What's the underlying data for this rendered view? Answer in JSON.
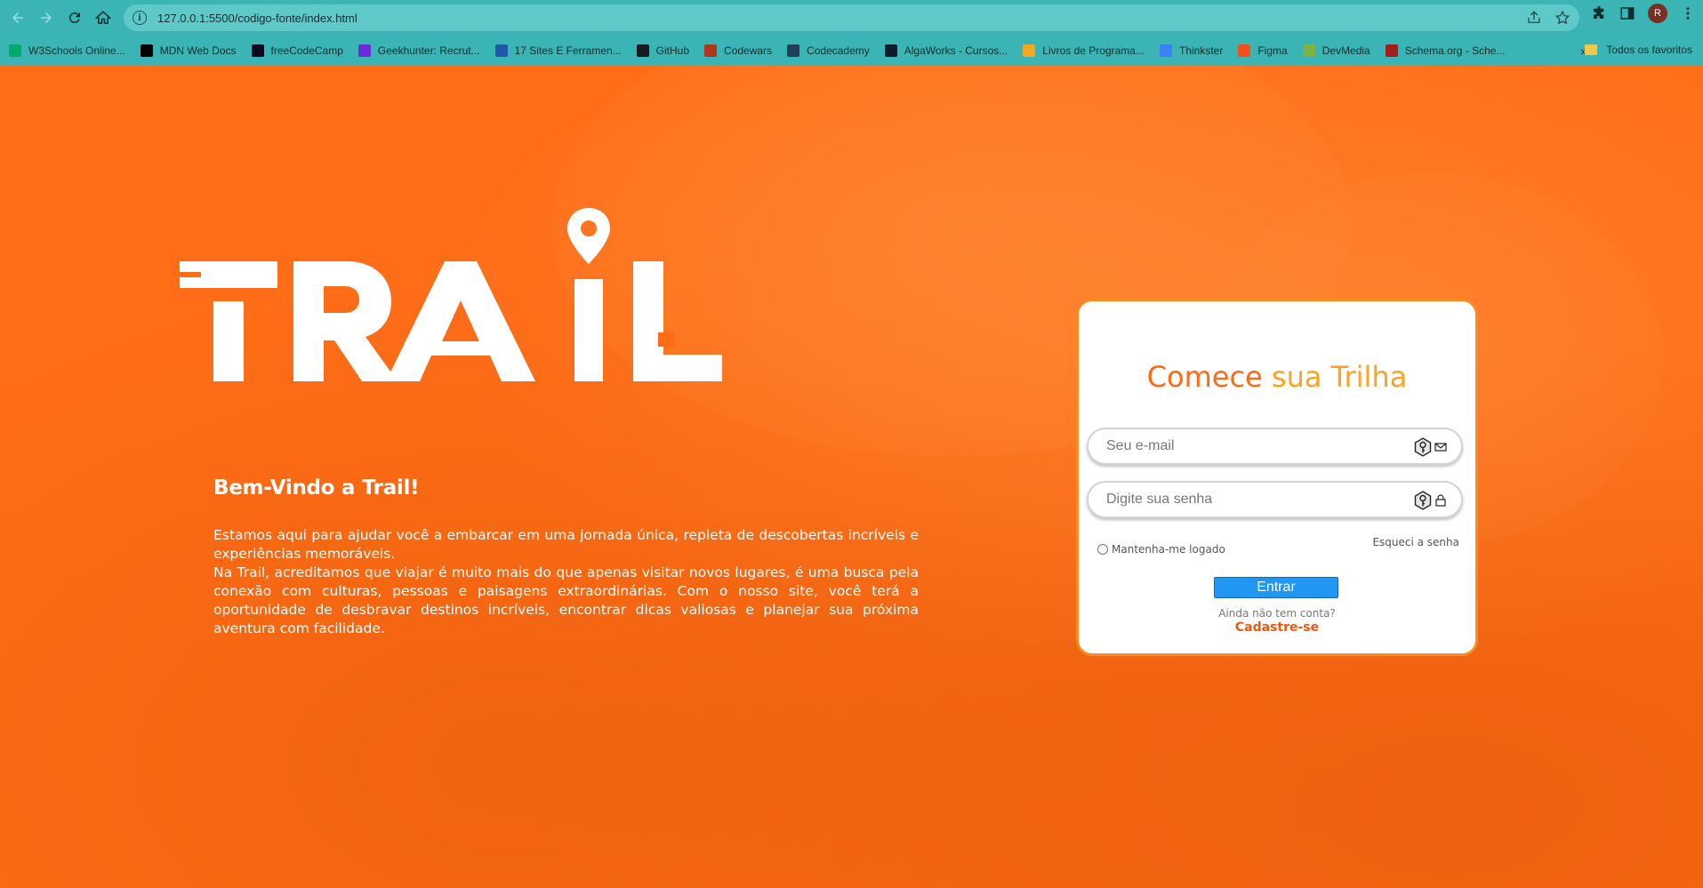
{
  "browser": {
    "url": "127.0.0.1:5500/codigo-fonte/index.html",
    "profile_initial": "R",
    "bookmarks": [
      {
        "label": "W3Schools Online...",
        "color": "#04aa6d"
      },
      {
        "label": "MDN Web Docs",
        "color": "#000000"
      },
      {
        "label": "freeCodeCamp",
        "color": "#0a0a23"
      },
      {
        "label": "Geekhunter: Recrut...",
        "color": "#6a2bd9"
      },
      {
        "label": "17 Sites E Ferramen...",
        "color": "#1e5aa8"
      },
      {
        "label": "GitHub",
        "color": "#161b22"
      },
      {
        "label": "Codewars",
        "color": "#b1361e"
      },
      {
        "label": "Codecademy",
        "color": "#1f4056"
      },
      {
        "label": "AlgaWorks - Cursos...",
        "color": "#0d1b2a"
      },
      {
        "label": "Livros de Programa...",
        "color": "#f5a623"
      },
      {
        "label": "Thinkster",
        "color": "#3b82f6"
      },
      {
        "label": "Figma",
        "color": "#f24e1e"
      },
      {
        "label": "DevMedia",
        "color": "#7cb342"
      },
      {
        "label": "Schema.org - Sche...",
        "color": "#a31d1d"
      }
    ],
    "bookmarks_overflow": "»",
    "all_favorites": "Todos os favoritos"
  },
  "hero": {
    "welcome_title": "Bem-Vindo a Trail!",
    "paragraph1": "Estamos aqui para ajudar você a embarcar em uma jornada única, repleta de descobertas incríveis e experiências memoráveis.",
    "paragraph2": "Na Trail, acreditamos que viajar é muito mais do que apenas visitar novos lugares, é uma busca pela conexão com culturas, pessoas e paisagens extraordinárias. Com o nosso site, você terá a oportunidade de desbravar destinos incríveis, encontrar dicas valiosas e planejar sua próxima aventura com facilidade."
  },
  "login": {
    "title_part1": "Comece ",
    "title_part2": "sua Trilha",
    "email_placeholder": "Seu e-mail",
    "password_placeholder": "Digite sua senha",
    "remember_label": "Mantenha-me logado",
    "forgot_label": "Esqueci a senha",
    "submit_label": "Entrar",
    "no_account_label": "Ainda não tem conta?",
    "signup_label": "Cadastre-se"
  },
  "colors": {
    "browser_chrome": "#3ab4b4",
    "background": "#ff6d17",
    "title_primary": "#ff6a13",
    "title_secondary": "#ffa21f",
    "button": "#2196f3"
  }
}
